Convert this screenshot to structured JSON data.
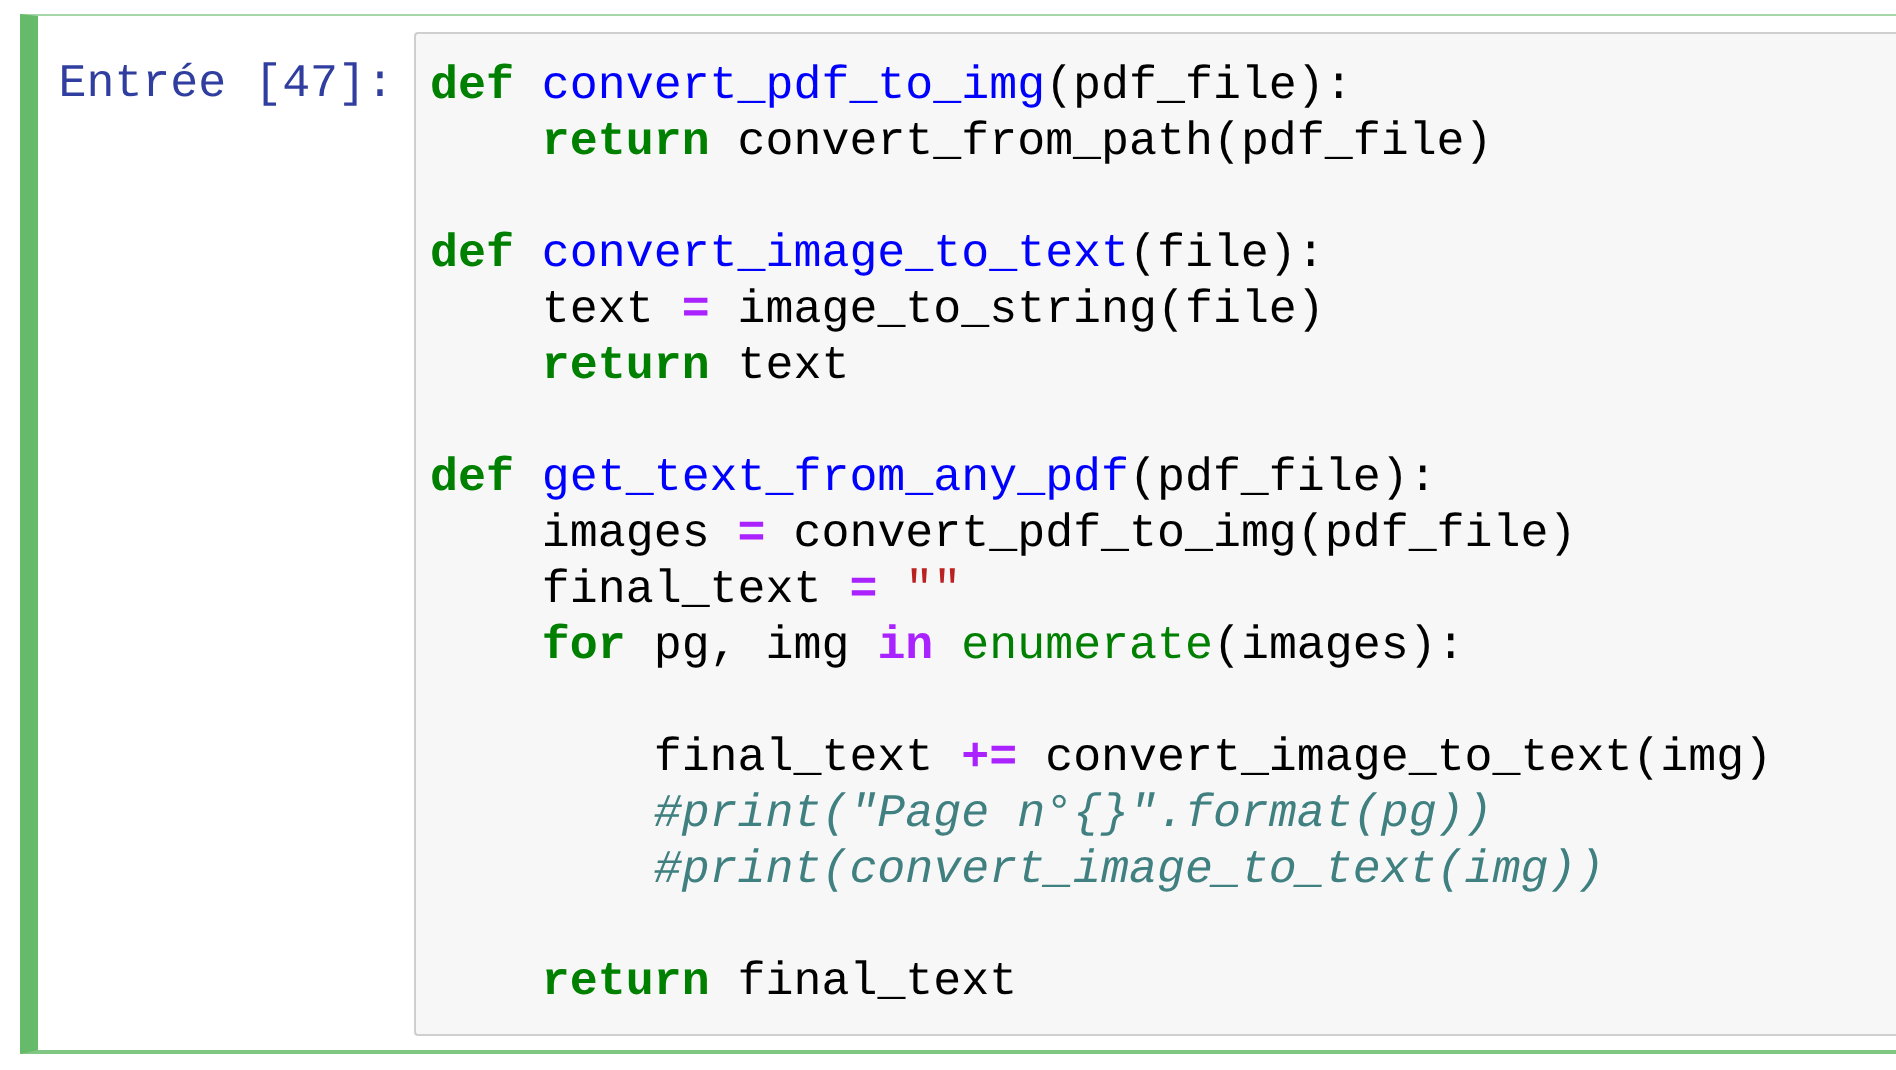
{
  "cell": {
    "selected": true,
    "prompt": "Entrée [47]:",
    "lines": [
      {
        "kind": "code",
        "tokens": [
          {
            "kind": "keyword",
            "text": "def "
          },
          {
            "kind": "name",
            "text": "convert_pdf_to_img"
          },
          {
            "kind": "plain",
            "text": "(pdf_file):"
          }
        ]
      },
      {
        "kind": "code",
        "tokens": [
          {
            "kind": "keyword",
            "text": "    return"
          },
          {
            "kind": "plain",
            "text": " convert_from_path(pdf_file)"
          }
        ]
      },
      {
        "kind": "blank"
      },
      {
        "kind": "code",
        "tokens": [
          {
            "kind": "keyword",
            "text": "def "
          },
          {
            "kind": "name",
            "text": "convert_image_to_text"
          },
          {
            "kind": "plain",
            "text": "(file):"
          }
        ]
      },
      {
        "kind": "code",
        "tokens": [
          {
            "kind": "plain",
            "text": "    text "
          },
          {
            "kind": "operator",
            "text": "="
          },
          {
            "kind": "plain",
            "text": " image_to_string(file)"
          }
        ]
      },
      {
        "kind": "code",
        "tokens": [
          {
            "kind": "keyword",
            "text": "    return"
          },
          {
            "kind": "plain",
            "text": " text"
          }
        ]
      },
      {
        "kind": "blank"
      },
      {
        "kind": "code",
        "tokens": [
          {
            "kind": "keyword",
            "text": "def "
          },
          {
            "kind": "name",
            "text": "get_text_from_any_pdf"
          },
          {
            "kind": "plain",
            "text": "(pdf_file):"
          }
        ]
      },
      {
        "kind": "code",
        "tokens": [
          {
            "kind": "plain",
            "text": "    images "
          },
          {
            "kind": "operator",
            "text": "="
          },
          {
            "kind": "plain",
            "text": " convert_pdf_to_img(pdf_file)"
          }
        ]
      },
      {
        "kind": "code",
        "tokens": [
          {
            "kind": "plain",
            "text": "    final_text "
          },
          {
            "kind": "operator",
            "text": "="
          },
          {
            "kind": "string",
            "text": " \"\""
          }
        ]
      },
      {
        "kind": "code",
        "tokens": [
          {
            "kind": "keyword",
            "text": "    for"
          },
          {
            "kind": "plain",
            "text": " pg, img "
          },
          {
            "kind": "operator",
            "text": "in "
          },
          {
            "kind": "builtin",
            "text": "enumerate"
          },
          {
            "kind": "plain",
            "text": "(images):"
          }
        ]
      },
      {
        "kind": "blank"
      },
      {
        "kind": "code",
        "tokens": [
          {
            "kind": "plain",
            "text": "        final_text "
          },
          {
            "kind": "operator",
            "text": "+="
          },
          {
            "kind": "plain",
            "text": " convert_image_to_text(img)"
          }
        ]
      },
      {
        "kind": "code",
        "tokens": [
          {
            "kind": "comment",
            "text": "        #print(\"Page n°{}\".format(pg))"
          }
        ]
      },
      {
        "kind": "code",
        "tokens": [
          {
            "kind": "comment",
            "text": "        #print(convert_image_to_text(img))"
          }
        ]
      },
      {
        "kind": "blank"
      },
      {
        "kind": "code",
        "tokens": [
          {
            "kind": "keyword",
            "text": "    return"
          },
          {
            "kind": "plain",
            "text": " final_text"
          }
        ]
      }
    ]
  }
}
